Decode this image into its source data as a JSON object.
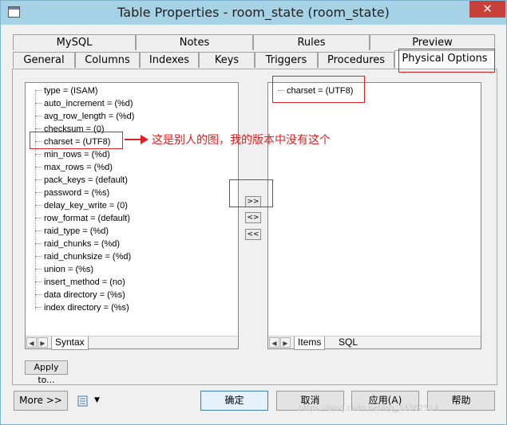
{
  "window": {
    "title": "Table Properties - room_state (room_state)",
    "close_label": "✕"
  },
  "tabs_row1": [
    {
      "label": "MySQL"
    },
    {
      "label": "Notes"
    },
    {
      "label": "Rules"
    },
    {
      "label": "Preview"
    }
  ],
  "tabs_row2": [
    {
      "label": "General"
    },
    {
      "label": "Columns"
    },
    {
      "label": "Indexes"
    },
    {
      "label": "Keys"
    },
    {
      "label": "Triggers"
    },
    {
      "label": "Procedures"
    },
    {
      "label": "Physical Options"
    }
  ],
  "left_list": {
    "items": [
      "type = (ISAM)",
      "auto_increment = (%d)",
      "avg_row_length = (%d)",
      "checksum = (0)",
      "charset = (UTF8)",
      "min_rows = (%d)",
      "max_rows = (%d)",
      "pack_keys = (default)",
      "password = (%s)",
      "delay_key_write = (0)",
      "row_format = (default)",
      "raid_type = (%d)",
      "raid_chunks = (%d)",
      "raid_chunksize = (%d)",
      "union = (%s)",
      "insert_method = (no)",
      "data directory = (%s)",
      "index directory = (%s)"
    ],
    "subtab": "Syntax"
  },
  "right_list": {
    "items": [
      "charset = (UTF8)"
    ],
    "subtabs": [
      "Items",
      "SQL"
    ]
  },
  "move_buttons": {
    "add": ">>",
    "swap": "<>",
    "remove": "<<"
  },
  "apply_to_label": "Apply to...",
  "annotation": "这是别人的图，我的版本中没有这个",
  "bottom": {
    "more_label": "More >>",
    "ok_label": "确定",
    "cancel_label": "取消",
    "apply_label": "应用(A)",
    "help_label": "帮助"
  },
  "watermark": "https://blog.csdn.net/qq_33362514"
}
